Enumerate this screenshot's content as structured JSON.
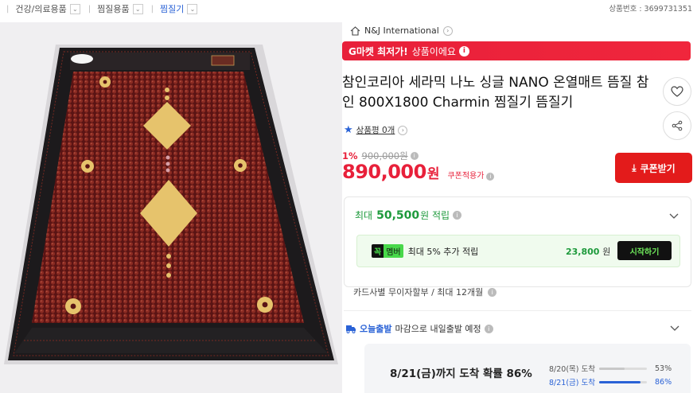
{
  "breadcrumb": [
    {
      "label": "건강/의료용품"
    },
    {
      "label": "찜질용품"
    },
    {
      "label": "찜질기"
    }
  ],
  "product_number_label": "상품번호 : 3699731351",
  "seller": {
    "name": "N&J International"
  },
  "gmarket_banner": {
    "bold": "G마켓 최저가!",
    "text": "상품이에요"
  },
  "title": "참인코리아 세라믹 나노 싱글 NANO 온열매트 뜸질 참인 800X1800 Charmin 찜질기 뜸질기",
  "rating": {
    "label": "상품평 0개"
  },
  "price": {
    "discount_rate": "1%",
    "original": "900,000원",
    "current": "890,000",
    "currency": "원",
    "coupon_note": "쿠폰적용가"
  },
  "coupon_button": {
    "label": "쿠폰받기"
  },
  "reward": {
    "prefix": "최대",
    "amount": "50,500",
    "suffix": "원 적립",
    "member_tag_k": "꼭",
    "member_tag_m": "멤버",
    "member_text": "최대 5% 추가 적립",
    "member_amount": "23,800",
    "member_currency": "원",
    "start_label": "시작하기"
  },
  "installment": {
    "label": "카드사별 무이자할부 / 최대 12개월"
  },
  "shipping": {
    "badge": "오늘출발",
    "text": "마감으로 내일출발 예정",
    "eta_main": "8/21(금)까지 도착 확률 86%",
    "eta": [
      {
        "date": "8/20(목) 도착",
        "percent": 53
      },
      {
        "date": "8/21(금) 도착",
        "percent": 86
      }
    ],
    "eta_pct_labels": [
      "53%",
      "86%"
    ]
  },
  "colors": {
    "accent_red": "#e8203a",
    "link_blue": "#2a62d6",
    "reward_green": "#1e9a3c"
  },
  "icons": [
    "chevron-down-icon",
    "home-icon",
    "info-icon",
    "heart-icon",
    "share-icon",
    "star-icon",
    "download-icon",
    "truck-icon"
  ]
}
